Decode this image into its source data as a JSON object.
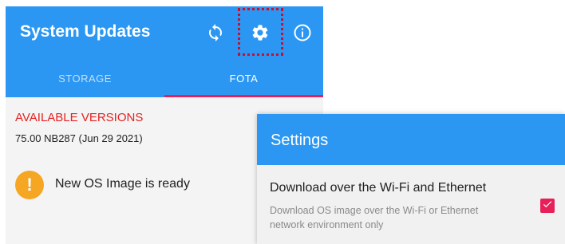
{
  "app": {
    "title": "System Updates"
  },
  "toolbar": {
    "sync_icon": "sync-icon",
    "settings_icon": "gear-icon",
    "info_icon": "info-icon"
  },
  "tabs": [
    {
      "label": "STORAGE",
      "selected": false
    },
    {
      "label": "FOTA",
      "selected": true
    }
  ],
  "content": {
    "section_heading": "AVAILABLE VERSIONS",
    "version": "75.00 NB287 (Jun 29 2021)",
    "status_icon": "!",
    "status_text": "New OS Image is ready"
  },
  "settings": {
    "title": "Settings",
    "preference": {
      "title": "Download over the Wi-Fi and Ethernet",
      "summary": "Download OS image over the Wi-Fi or Ethernet network environment only",
      "checked": true
    }
  },
  "colors": {
    "primary": "#2b97f2",
    "accent": "#e8205a",
    "heading_red": "#e32222",
    "warning": "#f5a623",
    "highlight_border": "#c8102e"
  }
}
